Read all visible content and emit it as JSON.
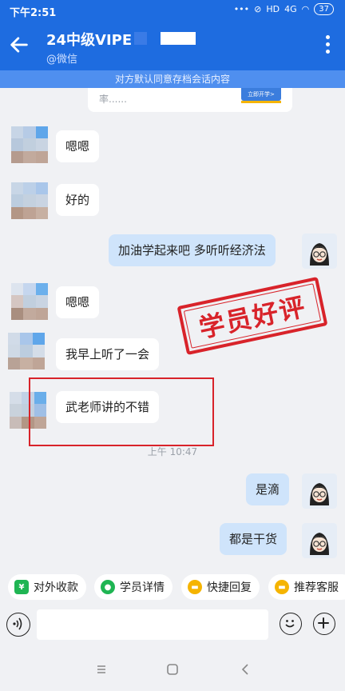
{
  "status_bar": {
    "time": "下午2:51",
    "signal": "4G",
    "battery": "37"
  },
  "header": {
    "title": "24中级VIPE",
    "subtitle": "@微信"
  },
  "notice": "对方默认同意存档会话内容",
  "card_partial": {
    "text": "率......",
    "button": "立即开学>"
  },
  "messages": [
    {
      "side": "them",
      "text": "嗯嗯"
    },
    {
      "side": "them",
      "text": "好的"
    },
    {
      "side": "me",
      "text": "加油学起来吧  多听听经济法"
    },
    {
      "side": "them",
      "text": "嗯嗯"
    },
    {
      "side": "them",
      "text": "我早上听了一会"
    },
    {
      "side": "them",
      "text": "武老师讲的不错"
    },
    {
      "side": "me",
      "text": "是滴"
    },
    {
      "side": "me",
      "text": "都是干货"
    }
  ],
  "timestamp": "上午 10:47",
  "stamp": "学员好评",
  "quick_actions": [
    {
      "label": "对外收款",
      "icon": "yen-icon",
      "color": "#1fb553"
    },
    {
      "label": "学员详情",
      "icon": "user-icon",
      "color": "#1fb553"
    },
    {
      "label": "快捷回复",
      "icon": "chat-icon",
      "color": "#f5b400"
    },
    {
      "label": "推荐客服",
      "icon": "service-icon",
      "color": "#f5b400"
    }
  ],
  "colors": {
    "brand": "#1e6ce0",
    "my_bubble": "#cfe4fb",
    "stamp_red": "#d8232a"
  }
}
